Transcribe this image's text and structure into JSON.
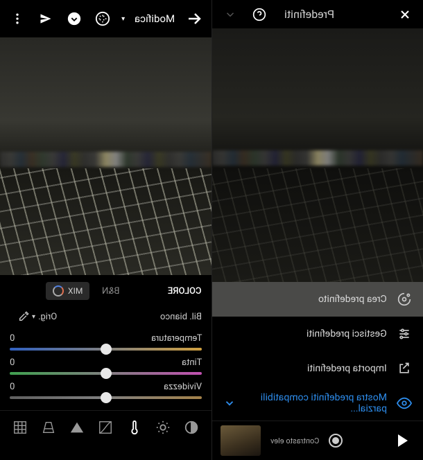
{
  "right_panel": {
    "mode_label": "Modifica",
    "tabs": {
      "colore": "COLORE",
      "bn": "B&N",
      "mix": "MIX"
    },
    "wb": {
      "label": "Bil. bianco",
      "value": "Orig."
    },
    "sliders": {
      "temperatura": {
        "label": "Temperatura",
        "value": "0",
        "pos": 50
      },
      "tinta": {
        "label": "Tinta",
        "value": "0",
        "pos": 50
      },
      "vividezza": {
        "label": "Vividezza",
        "value": "0",
        "pos": 50
      }
    }
  },
  "left_panel": {
    "title": "Predefiniti",
    "menu": {
      "crea": "Crea predefinito",
      "gestisci": "Gestisci predefiniti",
      "importa": "Importa predefiniti",
      "mostra": "Mostra predefiniti compatibili parzial..."
    },
    "bottom": {
      "caption": "Contrasto elev"
    }
  }
}
